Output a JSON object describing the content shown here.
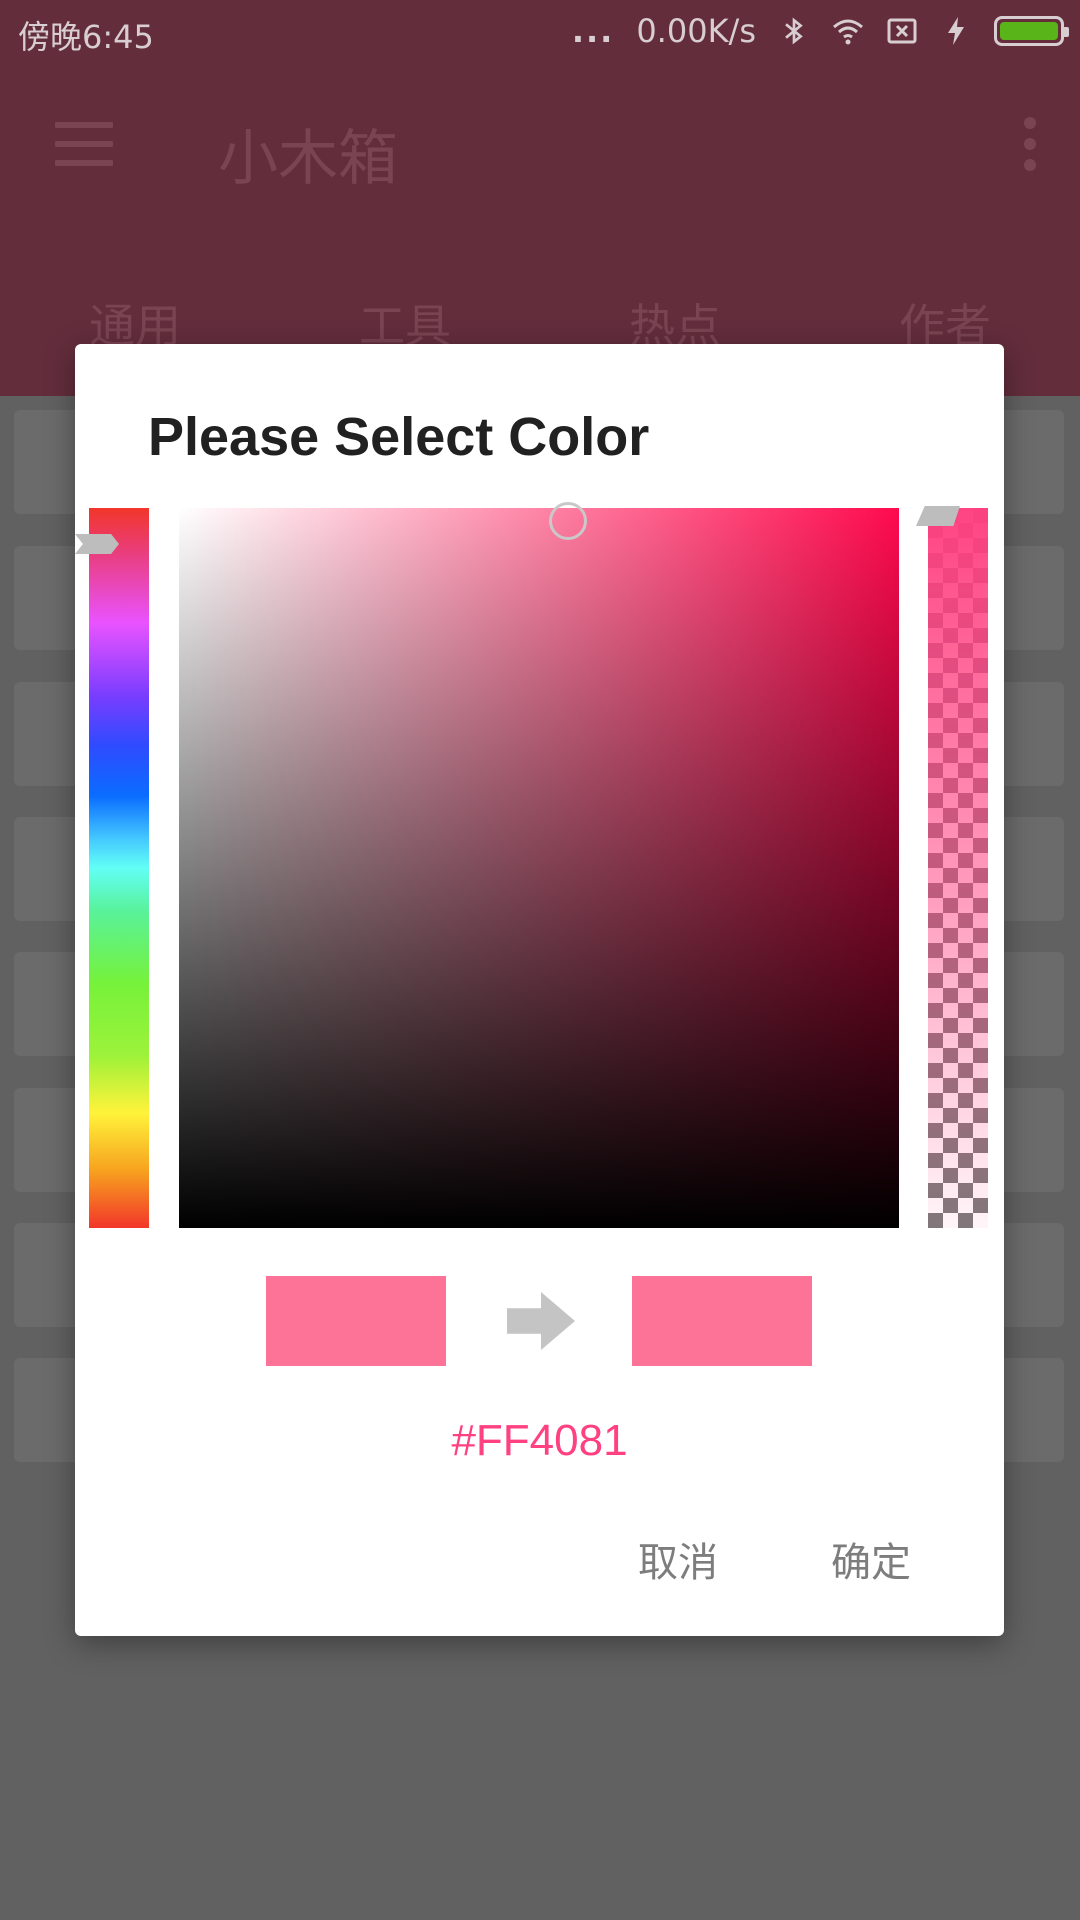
{
  "statusbar": {
    "time": "傍晚6:45",
    "dots": "...",
    "network_speed": "0.00K/s",
    "icons": [
      "bluetooth-icon",
      "wifi-icon",
      "sim-disabled-icon",
      "charging-icon",
      "battery-icon"
    ],
    "battery_color": "#59b41a"
  },
  "app": {
    "title": "小木箱",
    "tabs": [
      {
        "label": "通用"
      },
      {
        "label": "工具"
      },
      {
        "label": "热点"
      },
      {
        "label": "作者"
      }
    ],
    "primary_color": "#632d3c"
  },
  "dialog": {
    "title": "Please Select Color",
    "hex": "#FF4081",
    "old_color": "#fd7398",
    "new_color": "#fd7398",
    "cancel_label": "取消",
    "ok_label": "确定"
  }
}
